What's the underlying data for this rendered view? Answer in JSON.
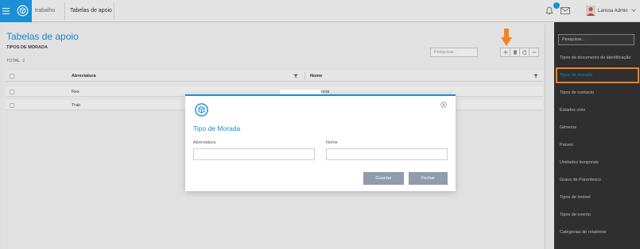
{
  "colors": {
    "accent": "#1a8fd1",
    "brand": "#1e9be5",
    "annotation": "#f58220",
    "sidebar_bg": "#333333",
    "modal_button": "#8e9cab"
  },
  "topbar": {
    "menu_icon": "hamburger-icon",
    "logo_icon": "app-logo-icon",
    "home_label": "trabalho",
    "active_tab": "Tabelas de apoio",
    "notifications_icon": "bell-icon",
    "messages_icon": "envelope-icon",
    "user_name": "Larissa Admin"
  },
  "main": {
    "title": "Tabelas de apoio",
    "subtitle": "TIPOS DE MORADA",
    "total_label": "TOTAL",
    "total_value": "2",
    "search_placeholder": "Pesquisar...",
    "toolbar_icons": [
      "add-icon",
      "trash-icon",
      "refresh-icon",
      "minus-icon"
    ],
    "table": {
      "columns": [
        "Abreviatura",
        "Nome"
      ],
      "rows": [
        {
          "abreviatura": "Res",
          "nome": "ncia"
        },
        {
          "abreviatura": "Trab",
          "nome": ""
        }
      ]
    }
  },
  "modal": {
    "title": "Tipo de Morada",
    "fields": [
      {
        "label": "Abreviatura",
        "value": ""
      },
      {
        "label": "Nome",
        "value": ""
      }
    ],
    "save_label": "Guardar",
    "close_label": "Fechar"
  },
  "sidebar": {
    "search_placeholder": "Pesquisar...",
    "active_index": 1,
    "items": [
      "Tipos de documento de identificação",
      "Tipos de morada",
      "Tipos de contacto",
      "Estados civis",
      "Géneros",
      "Países",
      "Unidades temporais",
      "Graus de Parentesco",
      "Tipos de Imóvel",
      "Tipos de evento",
      "Categorias de relatórios"
    ]
  }
}
